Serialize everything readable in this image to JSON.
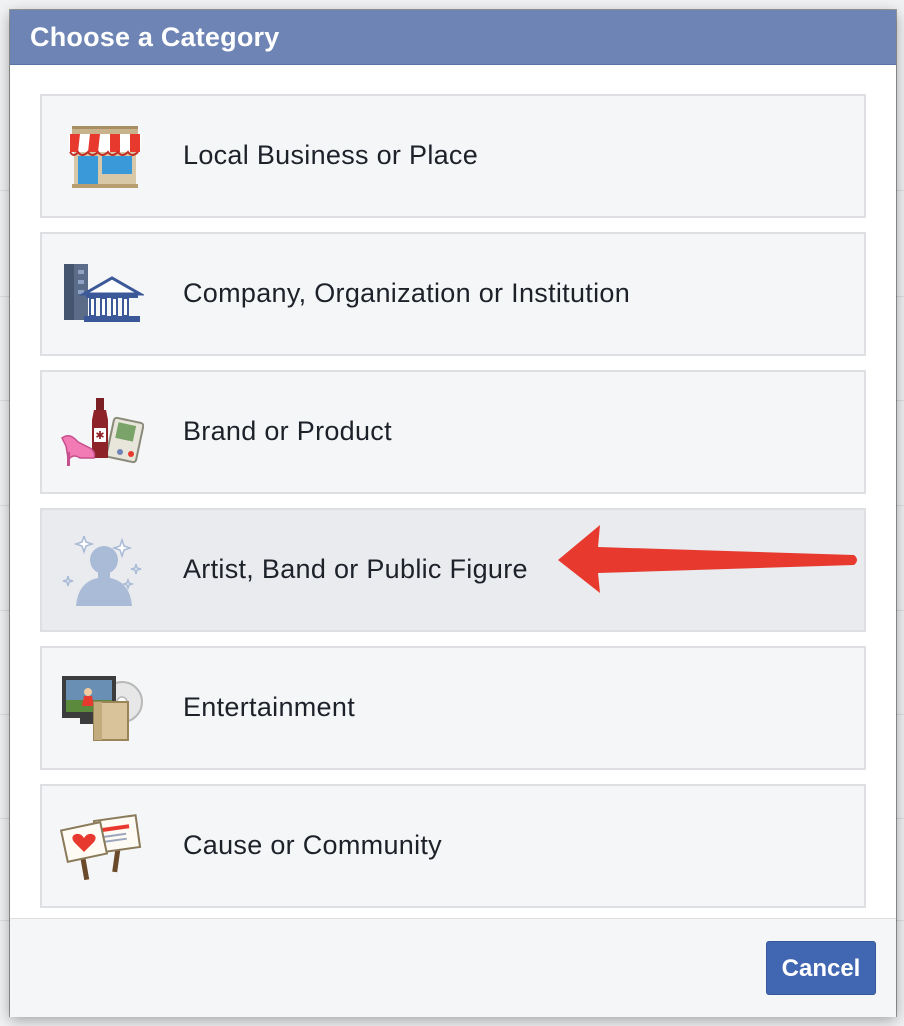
{
  "dialog": {
    "title": "Choose a Category",
    "cancel_label": "Cancel"
  },
  "options": [
    {
      "label": "Local Business or Place",
      "icon": "storefront-icon"
    },
    {
      "label": "Company, Organization or Institution",
      "icon": "buildings-icon"
    },
    {
      "label": "Brand or Product",
      "icon": "products-icon"
    },
    {
      "label": "Artist, Band or Public Figure",
      "icon": "public-figure-icon",
      "highlighted": true
    },
    {
      "label": "Entertainment",
      "icon": "tv-entertainment-icon"
    },
    {
      "label": "Cause or Community",
      "icon": "protest-signs-icon"
    }
  ],
  "annotation": {
    "arrow_color": "#e8392f",
    "points_to": "Artist, Band or Public Figure"
  },
  "colors": {
    "header": "#6d84b4",
    "button": "#4267b2",
    "option_bg": "#f5f6f7",
    "option_hover_bg": "#e9ebee"
  }
}
